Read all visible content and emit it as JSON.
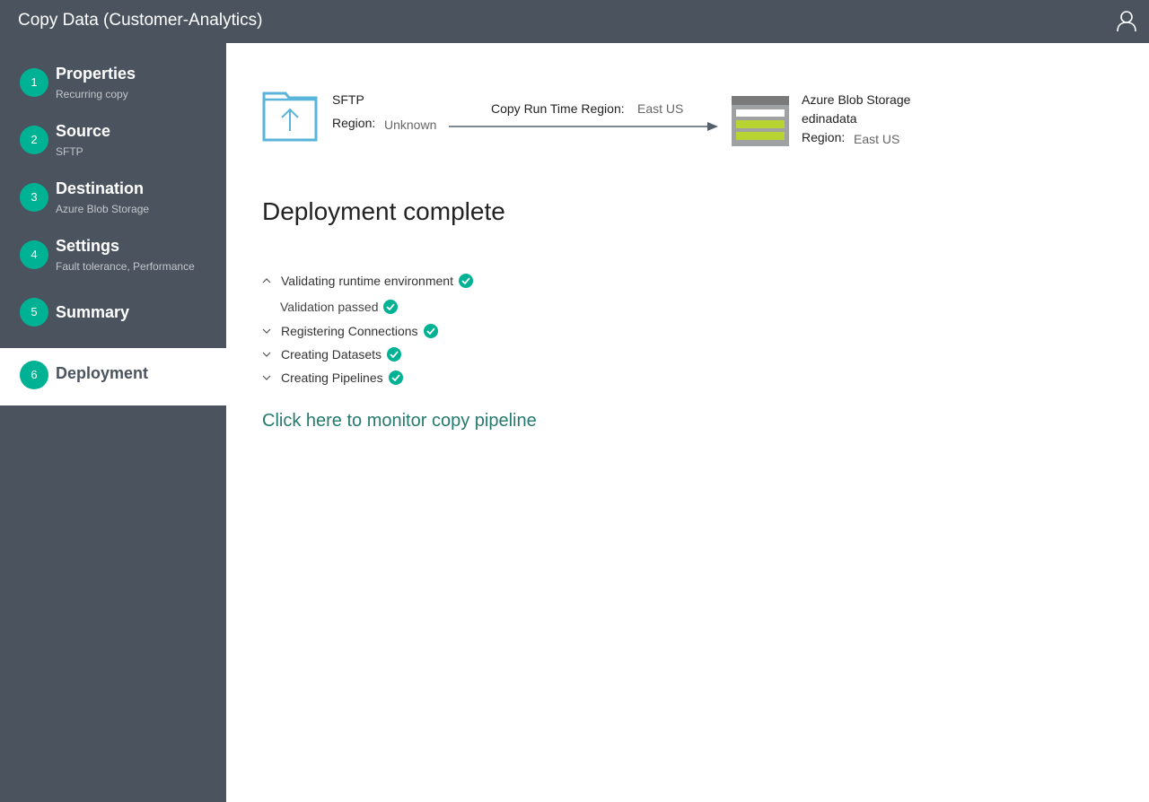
{
  "window": {
    "title": "Copy Data (Customer-Analytics)",
    "user_icon": "user-icon"
  },
  "sidebar": {
    "steps": [
      {
        "number": "1",
        "label": "Properties",
        "sub": "Recurring copy"
      },
      {
        "number": "2",
        "label": "Source",
        "sub": "SFTP"
      },
      {
        "number": "3",
        "label": "Destination",
        "sub": "Azure Blob Storage"
      },
      {
        "number": "4",
        "label": "Settings",
        "sub": "Fault tolerance, Performance"
      },
      {
        "number": "5",
        "label": "Summary",
        "sub": ""
      },
      {
        "number": "6",
        "label": "Deployment",
        "sub": ""
      }
    ],
    "active_step": "6"
  },
  "flow": {
    "source": {
      "name": "SFTP",
      "region_label": "Region:",
      "region_value": "Unknown",
      "icon": "folder-upload-icon"
    },
    "runtime": {
      "label": "Copy Run Time Region:",
      "value": "East US"
    },
    "destination": {
      "name": "Azure Blob Storage",
      "account": "edinadata",
      "region_label": "Region:",
      "region_value": "East US",
      "icon": "blob-storage-icon"
    }
  },
  "deployment": {
    "heading": "Deployment complete",
    "tasks": [
      {
        "label": "Validating runtime environment",
        "expanded": true
      },
      {
        "label": "Registering Connections",
        "expanded": false
      },
      {
        "label": "Creating Datasets",
        "expanded": false
      },
      {
        "label": "Creating Pipelines",
        "expanded": false
      }
    ],
    "subtask": "Validation passed",
    "monitor_link": "Click here to monitor copy pipeline"
  },
  "colors": {
    "sidebar_bg": "#4a535e",
    "accent": "#00b294",
    "link": "#247a6e"
  }
}
